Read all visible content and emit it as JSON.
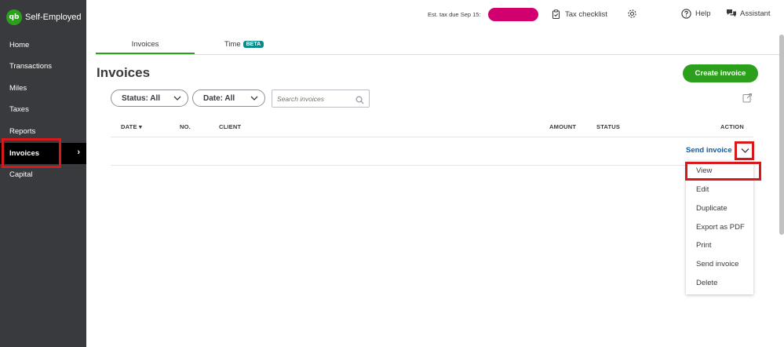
{
  "brand": {
    "logo": "qb",
    "name": "Self-Employed"
  },
  "sidebar": {
    "items": [
      {
        "label": "Home"
      },
      {
        "label": "Transactions"
      },
      {
        "label": "Miles"
      },
      {
        "label": "Taxes"
      },
      {
        "label": "Reports"
      },
      {
        "label": "Invoices",
        "active": true
      },
      {
        "label": "Capital"
      }
    ],
    "active_chevron": "›"
  },
  "topbar": {
    "est_tax_label": "Est. tax due Sep 15:",
    "tax_checklist": "Tax checklist",
    "help": "Help",
    "assistant": "Assistant"
  },
  "tabs": [
    {
      "label": "Invoices",
      "active": true
    },
    {
      "label": "Time",
      "badge": "BETA"
    }
  ],
  "page": {
    "title": "Invoices",
    "create_button": "Create invoice"
  },
  "filters": {
    "status": "Status: All",
    "date": "Date: All",
    "search_placeholder": "Search invoices"
  },
  "table": {
    "headers": {
      "date": "DATE ▾",
      "no": "NO.",
      "client": "CLIENT",
      "amount": "AMOUNT",
      "status": "STATUS",
      "action": "ACTION"
    }
  },
  "row": {
    "action_label": "Send invoice"
  },
  "action_menu": [
    "View",
    "Edit",
    "Duplicate",
    "Export as PDF",
    "Print",
    "Send invoice",
    "Delete"
  ],
  "colors": {
    "sidebar": "#393a3d",
    "accent_green": "#2ca01c",
    "link_blue": "#0d5ea6",
    "highlight_red": "#d7191c",
    "tax_pill": "#d1006e"
  }
}
